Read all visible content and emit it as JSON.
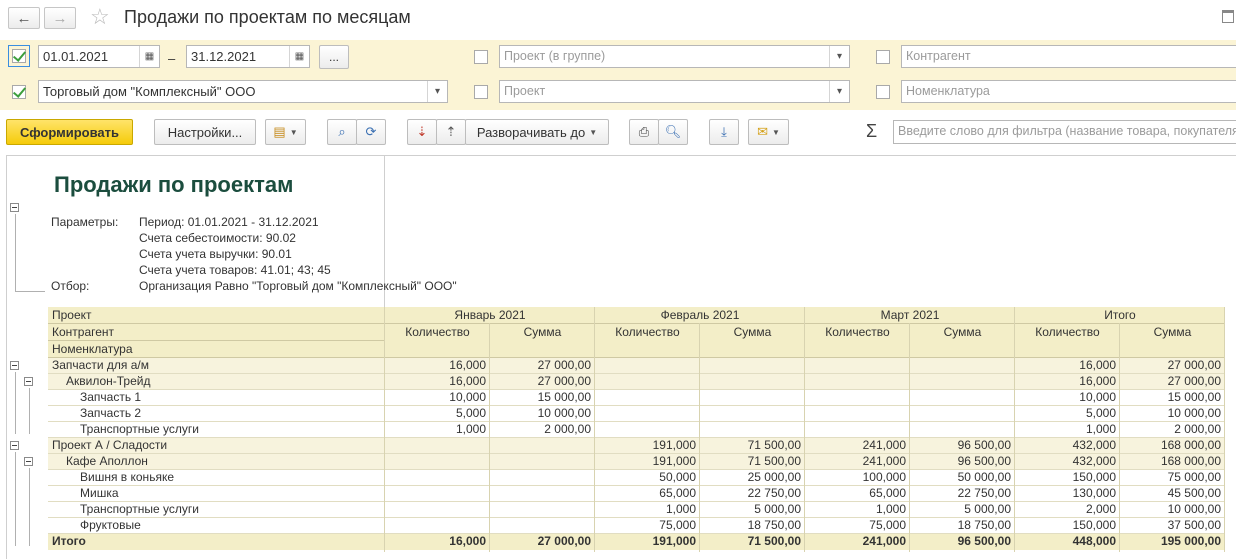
{
  "window": {
    "title": "Продажи по проектам по месяцам",
    "back_icon": "←",
    "forward_icon": "→",
    "star_icon": "☆"
  },
  "filters": {
    "period_enabled": true,
    "date_from": "01.01.2021",
    "dash": "–",
    "date_to": "31.12.2021",
    "period_button": "...",
    "org_enabled": true,
    "organization": "Торговый дом \"Комплексный\" ООО",
    "project_group_placeholder": "Проект (в группе)",
    "project_placeholder": "Проект",
    "contractor_placeholder": "Контрагент",
    "nomenclature_placeholder": "Номенклатура"
  },
  "toolbar": {
    "generate_label": "Сформировать",
    "settings_label": "Настройки...",
    "expand_label": "Разворачивать до",
    "filter_placeholder": "Введите слово для фильтра (название товара, покупателя",
    "sigma": "Σ"
  },
  "report": {
    "title": "Продажи по проектам",
    "params_label": "Параметры:",
    "params": [
      "Период: 01.01.2021 - 31.12.2021",
      "Счета себестоимости: 90.02",
      "Счета учета выручки: 90.01",
      "Счета учета товаров: 41.01; 43; 45"
    ],
    "filter_label": "Отбор:",
    "filter_value": "Организация Равно \"Торговый дом \"Комплексный\" ООО\"",
    "headers": {
      "row1": "Проект",
      "row2": "Контрагент",
      "row3": "Номенклатура",
      "months": [
        "Январь 2021",
        "Февраль 2021",
        "Март 2021",
        "Итого"
      ],
      "qty": "Количество",
      "sum": "Сумма"
    },
    "rows": [
      {
        "label": "Запчасти для а/м",
        "level": 0,
        "v": [
          "16,000",
          "27 000,00",
          "",
          "",
          "",
          "",
          "16,000",
          "27 000,00"
        ]
      },
      {
        "label": "Аквилон-Трейд",
        "level": 1,
        "v": [
          "16,000",
          "27 000,00",
          "",
          "",
          "",
          "",
          "16,000",
          "27 000,00"
        ]
      },
      {
        "label": "Запчасть 1",
        "level": 2,
        "v": [
          "10,000",
          "15 000,00",
          "",
          "",
          "",
          "",
          "10,000",
          "15 000,00"
        ]
      },
      {
        "label": "Запчасть 2",
        "level": 2,
        "v": [
          "5,000",
          "10 000,00",
          "",
          "",
          "",
          "",
          "5,000",
          "10 000,00"
        ]
      },
      {
        "label": "Транспортные услуги",
        "level": 2,
        "v": [
          "1,000",
          "2 000,00",
          "",
          "",
          "",
          "",
          "1,000",
          "2 000,00"
        ]
      },
      {
        "label": "Проект А / Сладости",
        "level": 0,
        "v": [
          "",
          "",
          "191,000",
          "71 500,00",
          "241,000",
          "96 500,00",
          "432,000",
          "168 000,00"
        ]
      },
      {
        "label": "Кафе Аполлон",
        "level": 1,
        "v": [
          "",
          "",
          "191,000",
          "71 500,00",
          "241,000",
          "96 500,00",
          "432,000",
          "168 000,00"
        ]
      },
      {
        "label": "Вишня в коньяке",
        "level": 2,
        "v": [
          "",
          "",
          "50,000",
          "25 000,00",
          "100,000",
          "50 000,00",
          "150,000",
          "75 000,00"
        ]
      },
      {
        "label": "Мишка",
        "level": 2,
        "v": [
          "",
          "",
          "65,000",
          "22 750,00",
          "65,000",
          "22 750,00",
          "130,000",
          "45 500,00"
        ]
      },
      {
        "label": "Транспортные услуги",
        "level": 2,
        "v": [
          "",
          "",
          "1,000",
          "5 000,00",
          "1,000",
          "5 000,00",
          "2,000",
          "10 000,00"
        ]
      },
      {
        "label": "Фруктовые",
        "level": 2,
        "v": [
          "",
          "",
          "75,000",
          "18 750,00",
          "75,000",
          "18 750,00",
          "150,000",
          "37 500,00"
        ]
      }
    ],
    "total": {
      "label": "Итого",
      "v": [
        "16,000",
        "27 000,00",
        "191,000",
        "71 500,00",
        "241,000",
        "96 500,00",
        "448,000",
        "195 000,00"
      ]
    }
  }
}
